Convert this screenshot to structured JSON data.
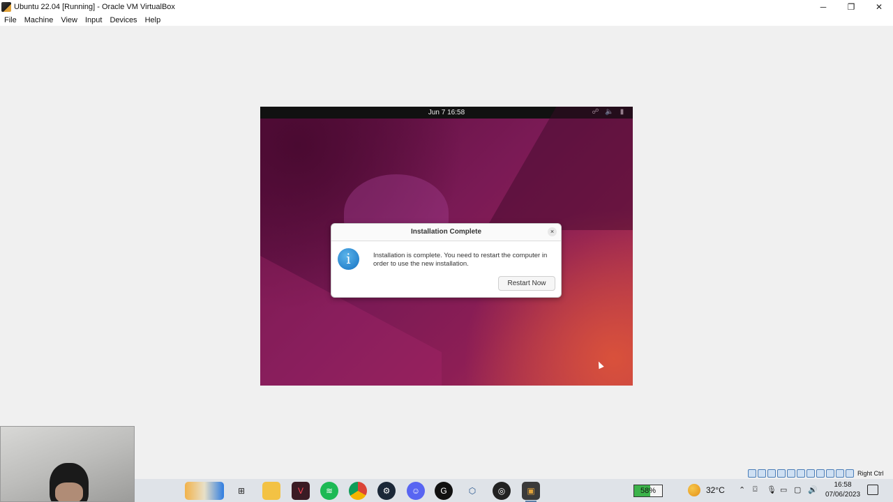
{
  "window": {
    "title": "Ubuntu 22.04 [Running] - Oracle VM VirtualBox",
    "controls": {
      "minimize": "─",
      "restore": "❐",
      "close": "✕"
    }
  },
  "menubar": {
    "items": [
      {
        "label": "File"
      },
      {
        "label": "Machine"
      },
      {
        "label": "View"
      },
      {
        "label": "Input"
      },
      {
        "label": "Devices"
      },
      {
        "label": "Help"
      }
    ]
  },
  "vm": {
    "top_bar": {
      "datetime": "Jun 7  16:58",
      "tray_icons": [
        "network-icon",
        "volume-icon",
        "battery-icon"
      ]
    },
    "dialog": {
      "title": "Installation Complete",
      "close_label": "×",
      "icon": "info-icon",
      "message": "Installation is complete. You need to restart the computer in order to use the new installation.",
      "button_label": "Restart Now"
    }
  },
  "vbox_status": {
    "host_key": "Right Ctrl"
  },
  "taskbar": {
    "apps": [
      "whiteboard-app-icon",
      "task-view-icon",
      "file-explorer-icon",
      "valorant-icon",
      "spotify-icon",
      "chrome-icon",
      "steam-icon",
      "discord-icon",
      "logitech-ghub-icon",
      "virtualbox-icon",
      "obs-icon",
      "vm-app-icon"
    ],
    "battery_level": "58%",
    "temperature": "32°C",
    "time": "16:58",
    "date": "07/06/2023"
  },
  "colors": {
    "ubuntu_wallpaper": "#7a1a55",
    "dialog_info": "#2a86cf",
    "taskbar_bg": "#dfe3e8"
  }
}
